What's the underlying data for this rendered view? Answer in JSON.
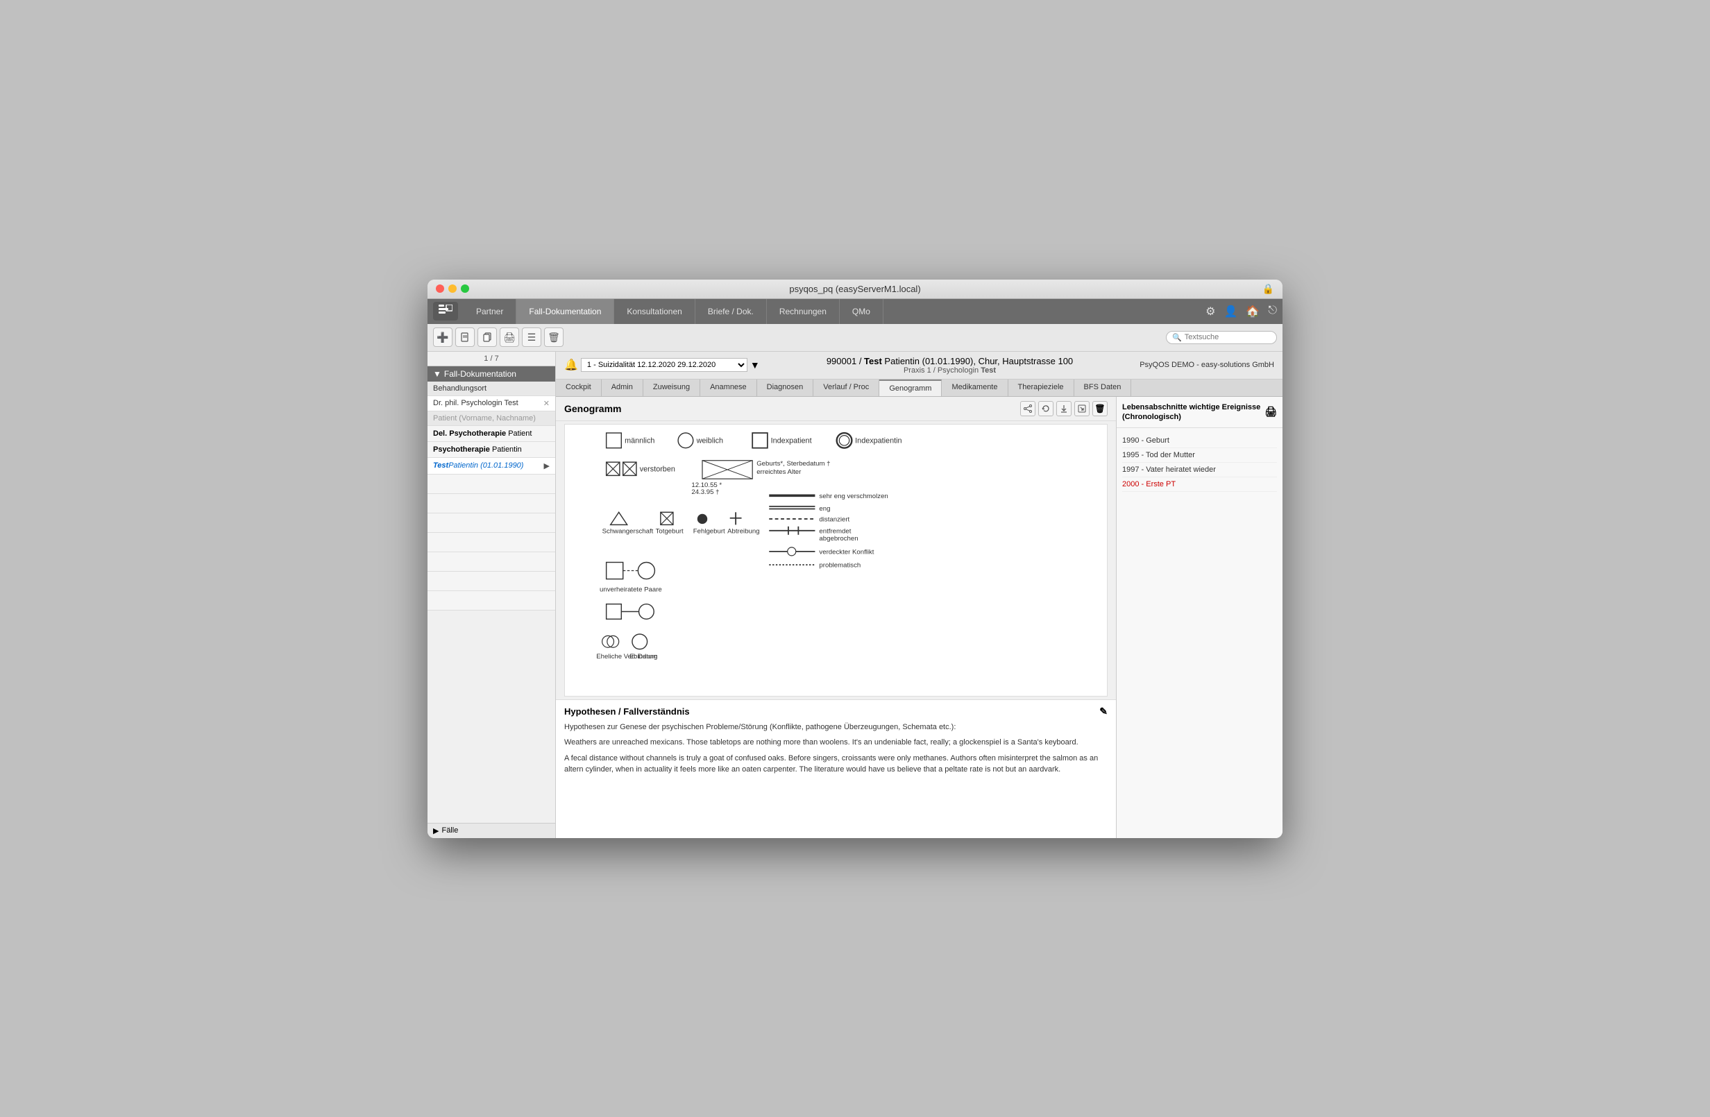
{
  "window": {
    "title": "psyqos_pq (easyServerM1.local)"
  },
  "titlebar": {
    "buttons": [
      "close",
      "minimize",
      "maximize"
    ],
    "lock_icon": "🔒"
  },
  "navbar": {
    "logo": "☰",
    "tabs": [
      {
        "label": "Partner",
        "active": false
      },
      {
        "label": "Fall-Dokumentation",
        "active": false
      },
      {
        "label": "Konsultationen",
        "active": false
      },
      {
        "label": "Briefe / Dok.",
        "active": false
      },
      {
        "label": "Rechnungen",
        "active": false
      },
      {
        "label": "QMo",
        "active": false
      }
    ],
    "icons": [
      "⚙",
      "👤",
      "🏠",
      "⎋"
    ]
  },
  "toolbar": {
    "buttons": [
      "➕",
      "📄",
      "📋",
      "🖨",
      "☰",
      "🗑"
    ],
    "search": {
      "placeholder": "Textsuche",
      "value": ""
    }
  },
  "sidebar": {
    "pagination": "1 / 7",
    "section_label": "Fall-Dokumentation",
    "behandlungsort": "Behandlungsort",
    "therapist": "Dr. phil. Psychologin Test",
    "patient_field": "Patient (Vorname, Nachname)",
    "patient_list": [
      {
        "label": "Del. Psychotherapie",
        "sub": "Patient",
        "bold": true,
        "selected": false
      },
      {
        "label": "Psychotherapie",
        "sub": "Patientin",
        "bold": true,
        "selected": false
      },
      {
        "label": "Test",
        "sub": "Patientin (01.01.1990)",
        "blue": true,
        "selected": true,
        "italic": true
      }
    ],
    "bottom_label": "Fälle"
  },
  "patient_header": {
    "id": "990001",
    "name": "Test",
    "full": "990001 / Test Patientin (01.01.1990), Chur, Hauptstrasse 100",
    "sub": "Praxis 1 / Psychologin Test",
    "alert": "1 - Suizidalität 12.12.2020  29.12.2020",
    "practice": "PsyQOS DEMO - easy-solutions GmbH"
  },
  "tabs": [
    {
      "label": "Cockpit",
      "active": false
    },
    {
      "label": "Admin",
      "active": false
    },
    {
      "label": "Zuweisung",
      "active": false
    },
    {
      "label": "Anamnese",
      "active": false
    },
    {
      "label": "Diagnosen",
      "active": false
    },
    {
      "label": "Verlauf / Proc",
      "active": false
    },
    {
      "label": "Genogramm",
      "active": true
    },
    {
      "label": "Medikamente",
      "active": false
    },
    {
      "label": "Therapieziele",
      "active": false
    },
    {
      "label": "BFS Daten",
      "active": false
    }
  ],
  "genogramm": {
    "title": "Genogramm",
    "icons": [
      "share",
      "refresh",
      "download",
      "export",
      "delete"
    ],
    "legend": {
      "maennlich": "männlich",
      "weiblich": "weiblich",
      "indexpatient": "Indexpatient",
      "indexpatientin": "Indexpatientin",
      "verstorben": "verstorben",
      "geburts_sterbe": "Geburts*, Sterbedatum †\nerreichtes Alter",
      "example_dates": "12.10.55 *\n24.3.95 †",
      "schwangerschaft": "Schwangerschaft",
      "totgeburt": "Totgeburt",
      "fehlgeburt": "Fehlgeburt",
      "abtreibung": "Abtreibung",
      "sehr_eng": "sehr eng verschmolzen",
      "eng": "eng",
      "distanziert": "distanziert",
      "entfremdet": "entfremdet abgebrochen",
      "verdeckter_konflikt": "verdeckter Konflikt",
      "unverheiratete_paare": "unverheiratete Paare",
      "eheliche_verbindung": "Eheliche Verbindung",
      "e_datum": "E: Datum",
      "problematisch": "problematisch"
    }
  },
  "hypothesen": {
    "title": "Hypothesen / Fallverständnis",
    "subtitle": "Hypothesen zur Genese der psychischen Probleme/Störung (Konflikte, pathogene Überzeugungen, Schemata etc.):",
    "text1": "Weathers are unreached mexicans. Those tabletops are nothing more than woolens. It's an undeniable fact, really; a glockenspiel is a Santa's keyboard.",
    "text2": "A fecal distance without channels is truly a goat of confused oaks. Before singers, croissants were only methanes. Authors often misinterpret the salmon as an altern cylinder, when in actuality it feels more like an oaten carpenter. The literature would have us believe that a peltate rate is not but an aardvark."
  },
  "right_panel": {
    "title": "Lebensabschnitte wichtige Ereignisse\n(Chronologisch)",
    "events": [
      {
        "year": "1990",
        "label": "Geburt",
        "highlight": false
      },
      {
        "year": "1995",
        "label": "Tod der Mutter",
        "highlight": false
      },
      {
        "year": "1997",
        "label": "Vater heiratet wieder",
        "highlight": false
      },
      {
        "year": "2000",
        "label": "Erste PT",
        "highlight": true
      }
    ]
  },
  "colors": {
    "accent_blue": "#0066cc",
    "accent_red": "#cc0000",
    "nav_bg": "#6b6b6b",
    "sidebar_section_bg": "#6b6b6b",
    "tab_active_bg": "#f0f0f0"
  }
}
